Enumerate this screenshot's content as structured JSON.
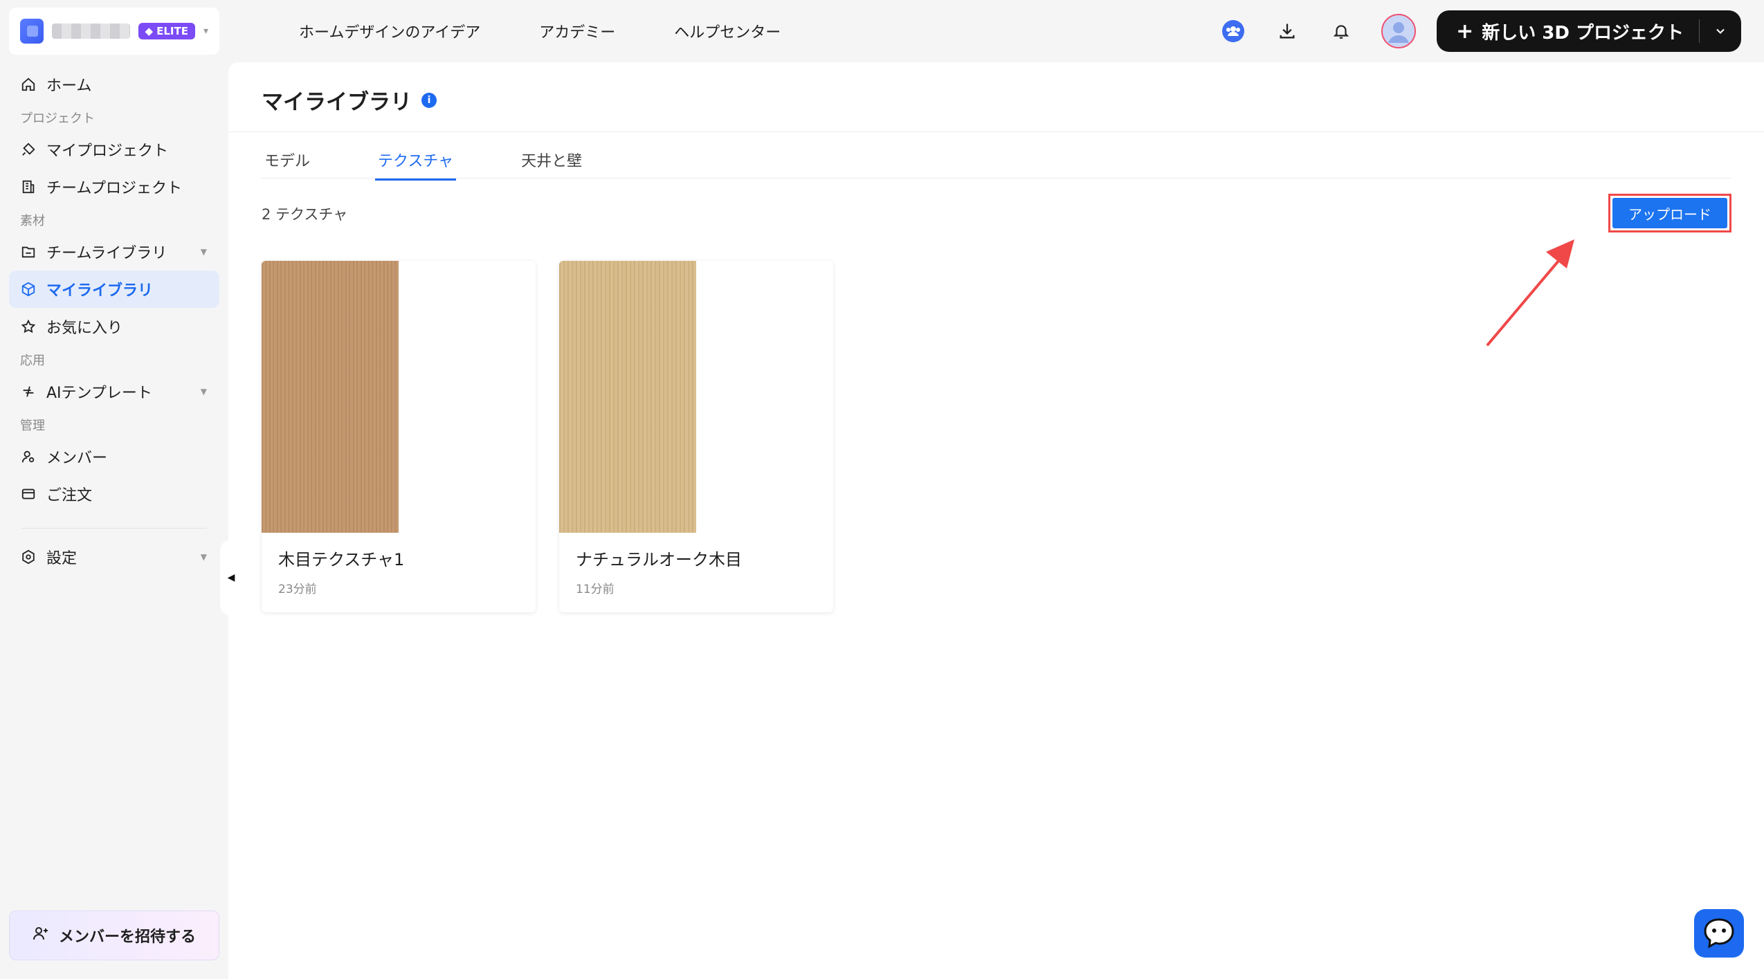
{
  "workspace": {
    "badge": "ELITE"
  },
  "sidebar": {
    "home": "ホーム",
    "section_project": "プロジェクト",
    "my_projects": "マイプロジェクト",
    "team_projects": "チームプロジェクト",
    "section_material": "素材",
    "team_library": "チームライブラリ",
    "my_library": "マイライブラリ",
    "favorites": "お気に入り",
    "section_apps": "応用",
    "ai_templates": "AIテンプレート",
    "section_admin": "管理",
    "members": "メンバー",
    "orders": "ご注文",
    "settings": "設定",
    "invite": "メンバーを招待する"
  },
  "topnav": {
    "links": [
      "ホームデザインのアイデア",
      "アカデミー",
      "ヘルプセンター"
    ],
    "new_project": "新しい 3D プロジェクト"
  },
  "main": {
    "title": "マイライブラリ",
    "tabs": [
      "モデル",
      "テクスチャ",
      "天井と壁"
    ],
    "active_tab": "テクスチャ",
    "count": "2 テクスチャ",
    "upload": "アップロード",
    "items": [
      {
        "name": "木目テクスチャ1",
        "time": "23分前",
        "swatch": "#c2946a"
      },
      {
        "name": "ナチュラルオーク木目",
        "time": "11分前",
        "swatch": "#d6b886"
      }
    ]
  },
  "colors": {
    "accent": "#1d6af0",
    "highlight": "#f04848",
    "elite": "#7b4bf5"
  }
}
